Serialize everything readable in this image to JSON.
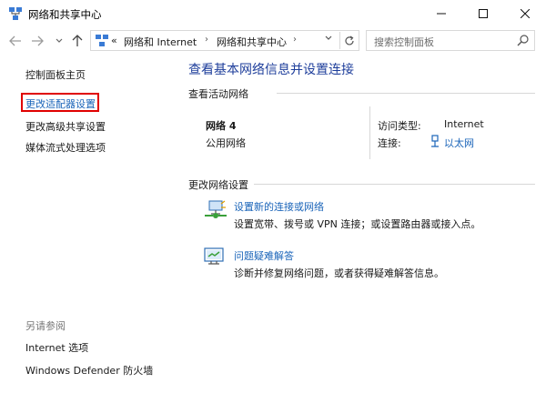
{
  "window": {
    "title": "网络和共享中心"
  },
  "address": {
    "prefix": "«",
    "crumbs": [
      "网络和 Internet",
      "网络和共享中心"
    ]
  },
  "search": {
    "placeholder": "搜索控制面板"
  },
  "sidebar": {
    "home": "控制面板主页",
    "adapter_settings": "更改适配器设置",
    "advanced_sharing": "更改高级共享设置",
    "media_streaming": "媒体流式处理选项",
    "see_also_label": "另请参阅",
    "internet_options": "Internet 选项",
    "defender_firewall": "Windows Defender 防火墙"
  },
  "main": {
    "title": "查看基本网络信息并设置连接",
    "active_networks_label": "查看活动网络",
    "network": {
      "name": "网络 4",
      "type": "公用网络",
      "access_type_label": "访问类型:",
      "access_type_value": "Internet",
      "connections_label": "连接:",
      "connections_value": "以太网"
    },
    "change_settings_label": "更改网络设置",
    "setup_link": "设置新的连接或网络",
    "setup_desc": "设置宽带、拨号或 VPN 连接；或设置路由器或接入点。",
    "troubleshoot_link": "问题疑难解答",
    "troubleshoot_desc": "诊断并修复网络问题，或者获得疑难解答信息。"
  },
  "colors": {
    "link": "#1a64b9",
    "title": "#1e3e9b",
    "highlight_box": "#e00000"
  }
}
